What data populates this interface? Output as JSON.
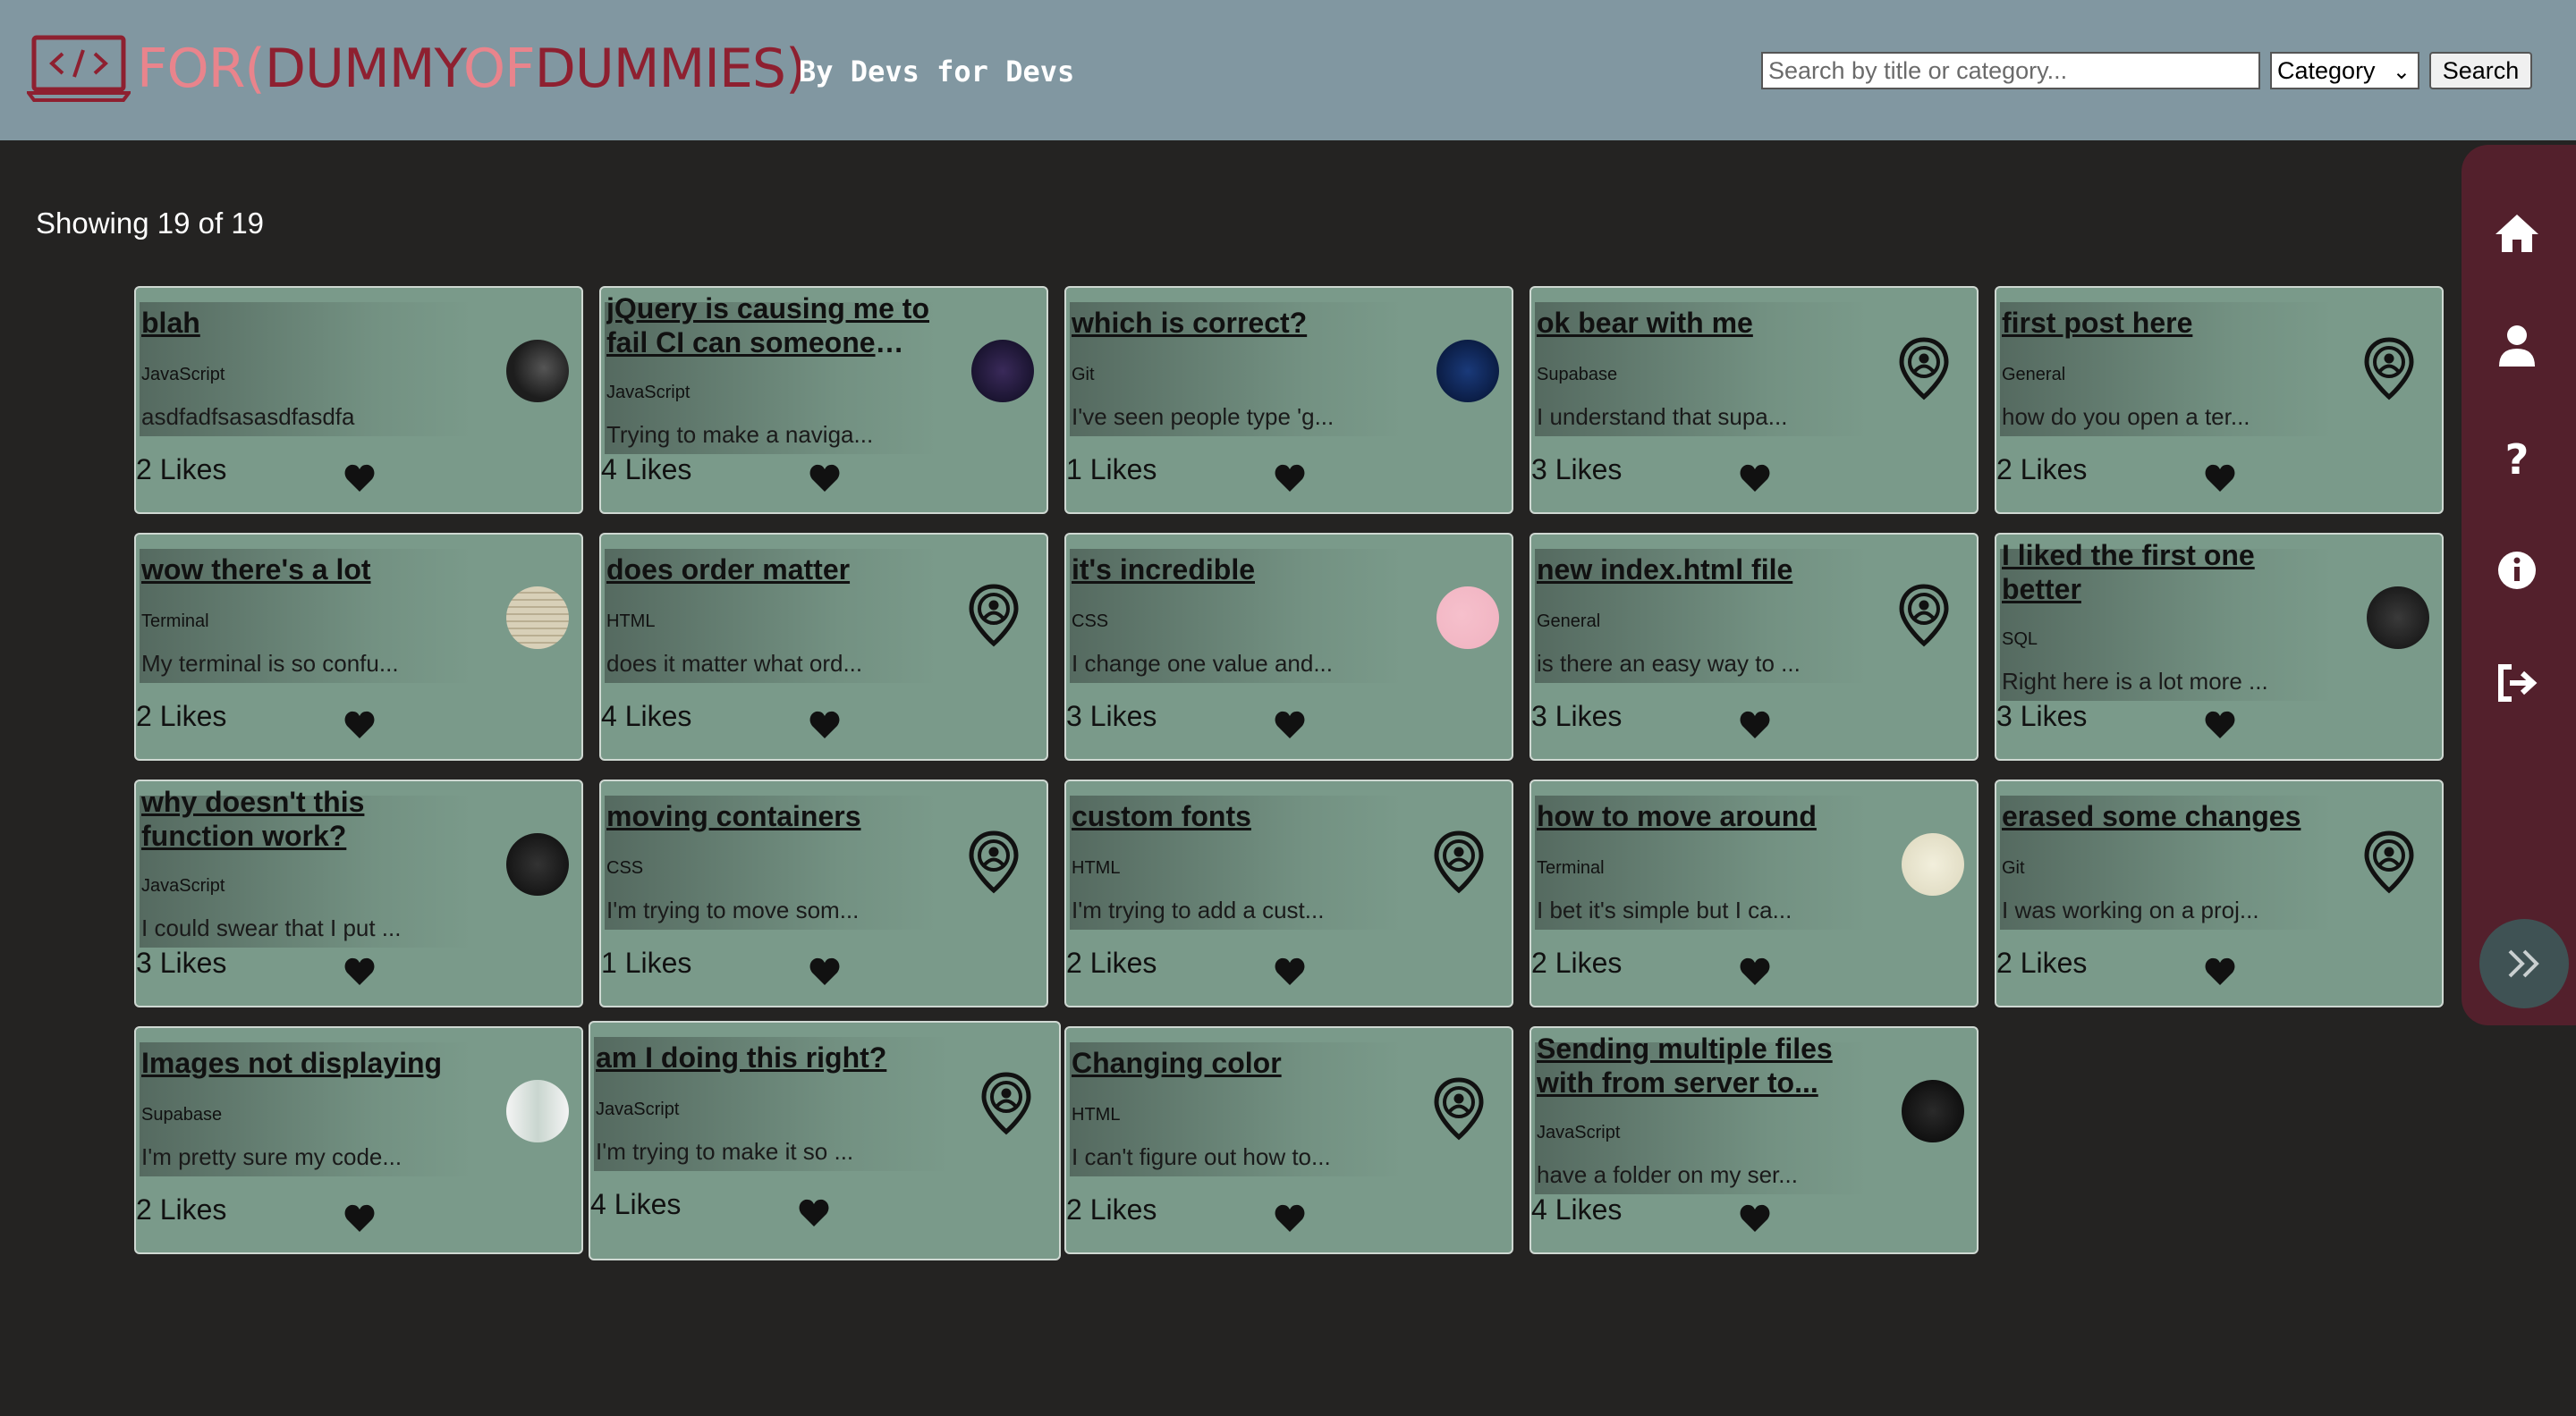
{
  "header": {
    "brand": {
      "p1": "FOR(",
      "p2": "DUMMY",
      "p3": "OF",
      "p4": "DUMMIES)"
    },
    "tagline": "By Devs for Devs",
    "logo_icon": "laptop-code-icon",
    "search_placeholder": "Search by title or category...",
    "search_value": "",
    "category_selected": "Category",
    "search_button": "Search",
    "colors": {
      "bar": "#8197a1",
      "brand_light": "#e9848c",
      "brand_dark": "#8e2030"
    }
  },
  "count_text": "Showing 19 of 19",
  "posts": [
    {
      "title": "blah",
      "category": "JavaScript",
      "excerpt": "asdfadfsasasdfasdfa",
      "likes": "2 Likes",
      "thumb": "avatar"
    },
    {
      "title": "jQuery is causing me to fail CI can someone hel...",
      "category": "JavaScript",
      "excerpt": "Trying to make a naviga...",
      "likes": "4 Likes",
      "thumb": "avatar"
    },
    {
      "title": "which is correct?",
      "category": "Git",
      "excerpt": "I've seen people type 'g...",
      "likes": "1 Likes",
      "thumb": "avatar"
    },
    {
      "title": "ok bear with me",
      "category": "Supabase",
      "excerpt": "I understand that supa...",
      "likes": "3 Likes",
      "thumb": "location-user-icon"
    },
    {
      "title": "first post here",
      "category": "General",
      "excerpt": "how do you open a ter...",
      "likes": "2 Likes",
      "thumb": "location-user-icon"
    },
    {
      "title": "wow there's a lot",
      "category": "Terminal",
      "excerpt": "My terminal is so confu...",
      "likes": "2 Likes",
      "thumb": "avatar"
    },
    {
      "title": "does order matter",
      "category": "HTML",
      "excerpt": "does it matter what ord...",
      "likes": "4 Likes",
      "thumb": "location-user-icon"
    },
    {
      "title": "it's incredible",
      "category": "CSS",
      "excerpt": "I change one value and...",
      "likes": "3 Likes",
      "thumb": "avatar"
    },
    {
      "title": "new index.html file",
      "category": "General",
      "excerpt": "is there an easy way to ...",
      "likes": "3 Likes",
      "thumb": "location-user-icon"
    },
    {
      "title": "I liked the first one better",
      "category": "SQL",
      "excerpt": "Right here is a lot more ...",
      "likes": "3 Likes",
      "thumb": "avatar"
    },
    {
      "title": "why doesn't this function work?",
      "category": "JavaScript",
      "excerpt": "I could swear that I put ...",
      "likes": "3 Likes",
      "thumb": "avatar"
    },
    {
      "title": "moving containers",
      "category": "CSS",
      "excerpt": "I'm trying to move som...",
      "likes": "1 Likes",
      "thumb": "location-user-icon"
    },
    {
      "title": "custom fonts",
      "category": "HTML",
      "excerpt": "I'm trying to add a cust...",
      "likes": "2 Likes",
      "thumb": "location-user-icon"
    },
    {
      "title": "how to move around",
      "category": "Terminal",
      "excerpt": "I bet it's simple but I ca...",
      "likes": "2 Likes",
      "thumb": "avatar"
    },
    {
      "title": "erased some changes",
      "category": "Git",
      "excerpt": "I was working on a proj...",
      "likes": "2 Likes",
      "thumb": "location-user-icon"
    },
    {
      "title": "Images not displaying",
      "category": "Supabase",
      "excerpt": "I'm pretty sure my code...",
      "likes": "2 Likes",
      "thumb": "avatar"
    },
    {
      "title": "am I doing this right?",
      "category": "JavaScript",
      "excerpt": "I'm trying to make it so ...",
      "likes": "4 Likes",
      "thumb": "location-user-icon"
    },
    {
      "title": "Changing color",
      "category": "HTML",
      "excerpt": "I can't figure out how to...",
      "likes": "2 Likes",
      "thumb": "location-user-icon"
    },
    {
      "title": "Sending multiple files with from server to...",
      "category": "JavaScript",
      "excerpt": "have a folder on my ser...",
      "likes": "4 Likes",
      "thumb": "avatar"
    }
  ],
  "sidebar": {
    "items": [
      "home-icon",
      "user-icon",
      "question-icon",
      "info-icon",
      "logout-icon"
    ],
    "expand_icon": "double-chevron-right-icon",
    "color": "#53202c"
  }
}
